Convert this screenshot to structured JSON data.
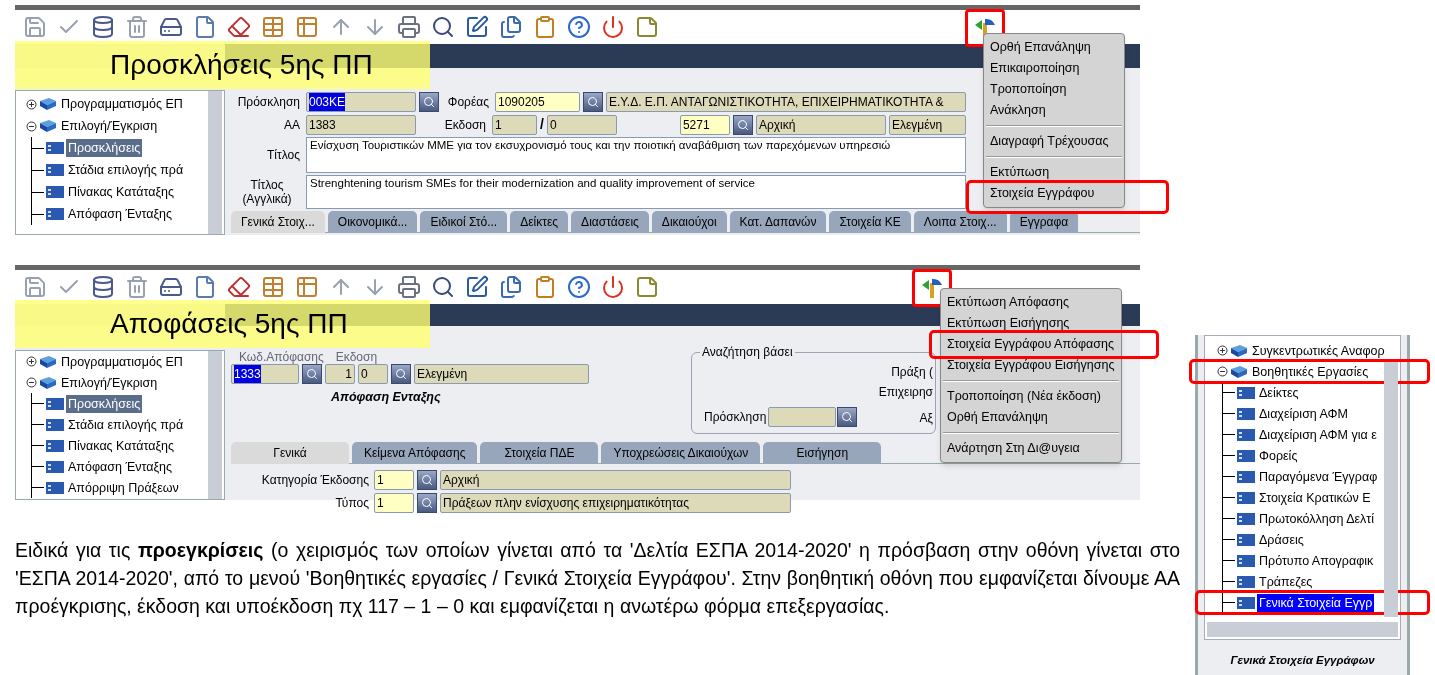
{
  "calls_screen": {
    "overlay_label": "Προσκλήσεις 5ης ΠΠ",
    "tools_button": {
      "highlighted": true
    },
    "tree": [
      {
        "label": "Προγραμματισμός ΕΠ",
        "expanded": false,
        "selected": false
      },
      {
        "label": "Επιλογή/Έγκριση",
        "expanded": true,
        "selected": false,
        "children": [
          {
            "label": "Προσκλήσεις",
            "selected": true
          },
          {
            "label": "Στάδια επιλογής πρά",
            "selected": false
          },
          {
            "label": "Πίνακας Κατάταξης",
            "selected": false
          },
          {
            "label": "Απόφαση Ένταξης",
            "selected": false
          }
        ]
      }
    ],
    "form": {
      "call_label": "Πρόσκληση",
      "call": {
        "value": "003ΚΕ",
        "editable": false,
        "text_selected": true
      },
      "body_label": "Φορέας",
      "body_code": {
        "value": "1090205",
        "editable": true,
        "text_selected": false
      },
      "body_name": {
        "value": "Ε.Υ.Δ. Ε.Π. ΑΝΤΑΓΩΝΙΣΤΙΚΟΤΗΤΑ, ΕΠΙΧΕΙΡΗΜΑΤΙΚΟΤΗΤΑ &",
        "editable": false,
        "text_selected": false
      },
      "aa_label": "ΑΑ",
      "aa": {
        "value": "1383",
        "editable": false,
        "text_selected": false
      },
      "version_label": "Εκδοση",
      "version": {
        "value": "1",
        "editable": false,
        "text_selected": false
      },
      "version_separator": "/",
      "subversion": {
        "value": "0",
        "editable": false,
        "text_selected": false
      },
      "type_code": {
        "value": "5271",
        "editable": true,
        "text_selected": false
      },
      "type_name": {
        "value": "Αρχική",
        "editable": false,
        "text_selected": false
      },
      "status": {
        "value": "Ελεγμένη",
        "editable": false,
        "text_selected": false
      },
      "title_label": "Τίτλος",
      "title": "Ενίσχυση Τουριστικών ΜΜΕ για τον εκσυχρονισμό τους και την ποιοτική αναβάθμιση των παρεχόμενων υπηρεσιώ",
      "title_en_label": [
        "Τίτλος",
        "(Αγγλικά)"
      ],
      "title_en": "Strenghtening tourism SMEs for their modernization and quality improvement of service"
    },
    "tabs": [
      {
        "label": "Γενικά Στοιχ...",
        "selected": true
      },
      {
        "label": "Οικονομικά...",
        "selected": false
      },
      {
        "label": "Ειδικοί Στό...",
        "selected": false
      },
      {
        "label": "Δείκτες",
        "selected": false
      },
      {
        "label": "Διαστάσεις",
        "selected": false
      },
      {
        "label": "Δικαιούχοι",
        "selected": false
      },
      {
        "label": "Κατ. Δαπανών",
        "selected": false
      },
      {
        "label": "Στοιχεία ΚΕ",
        "selected": false
      },
      {
        "label": "Λοιπα Στοιχ...",
        "selected": false
      },
      {
        "label": "Εγγραφα",
        "selected": false
      }
    ],
    "menu": [
      {
        "kind": "item",
        "label": "Ορθή Επανάληψη",
        "highlighted": false
      },
      {
        "kind": "item",
        "label": "Επικαιροποίηση",
        "highlighted": false
      },
      {
        "kind": "item",
        "label": "Τροποποίηση",
        "highlighted": false
      },
      {
        "kind": "item",
        "label": "Ανάκληση",
        "highlighted": false
      },
      {
        "kind": "separator"
      },
      {
        "kind": "item",
        "label": "Διαγραφή Τρέχουσας",
        "highlighted": false
      },
      {
        "kind": "separator"
      },
      {
        "kind": "item",
        "label": "Εκτύπωση",
        "highlighted": false
      },
      {
        "kind": "item",
        "label": "Στοιχεία Εγγράφου",
        "highlighted": true
      }
    ]
  },
  "decisions_screen": {
    "overlay_label": "Αποφάσεις 5ης ΠΠ",
    "tools_button": {
      "highlighted": true
    },
    "tree": [
      {
        "label": "Προγραμματισμός ΕΠ",
        "expanded": false,
        "selected": false
      },
      {
        "label": "Επιλογή/Έγκριση",
        "expanded": true,
        "selected": false,
        "children": [
          {
            "label": "Προσκλήσεις",
            "selected": true
          },
          {
            "label": "Στάδια επιλογής πρά",
            "selected": false
          },
          {
            "label": "Πίνακας Κατάταξης",
            "selected": false
          },
          {
            "label": "Απόφαση Ένταξης",
            "selected": false
          },
          {
            "label": "Απόρριψη Πράξεων",
            "selected": false
          }
        ]
      }
    ],
    "form": {
      "code_label": "Κωδ.Απόφασης",
      "version_label": "Εκδοση",
      "code": {
        "value": "1333",
        "editable": false,
        "text_selected": true
      },
      "version": {
        "value": "1",
        "editable": false,
        "text_selected": false
      },
      "subversion": {
        "value": "0",
        "editable": false,
        "text_selected": false
      },
      "status": {
        "value": "Ελεγμένη",
        "editable": false,
        "text_selected": false
      },
      "caption": "Απόφαση Ενταξης",
      "search_group": {
        "legend": "Αναζήτηση βάσει",
        "project_label": "Πράξη (",
        "business_label": "Επιχειρησ",
        "call_label": "Πρόσκληση",
        "call": {
          "editable": false
        },
        "score_label": "Αξ"
      }
    },
    "tabs": [
      {
        "label": "Γενικά",
        "selected": true
      },
      {
        "label": "Κείμενα Απόφασης",
        "selected": false
      },
      {
        "label": "Στοιχεία ΠΔΕ",
        "selected": false
      },
      {
        "label": "Υποχρεώσεις Δικαιούχων",
        "selected": false
      },
      {
        "label": "Εισήγηση",
        "selected": false
      }
    ],
    "rows": [
      {
        "label": "Κατηγορία Έκδοσης",
        "code": {
          "value": "1",
          "editable": true,
          "text_selected": false
        },
        "description": {
          "value": "Αρχική",
          "editable": false,
          "text_selected": false
        }
      },
      {
        "label": "Τύπος",
        "code": {
          "value": "1",
          "editable": true,
          "text_selected": false
        },
        "description": {
          "value": "Πράξεων πλην ενίσχυσης επιχειρηματικότητας",
          "editable": false,
          "text_selected": false
        }
      }
    ],
    "menu": [
      {
        "kind": "item",
        "label": "Εκτύπωση Απόφασης",
        "highlighted": false
      },
      {
        "kind": "item",
        "label": "Εκτύπωση Εισήγησης",
        "highlighted": false
      },
      {
        "kind": "item",
        "label": "Στοιχεία Εγγράφου Απόφασης",
        "highlighted": true
      },
      {
        "kind": "item",
        "label": "Στοιχεία Εγγράφου Εισήγησης",
        "highlighted": false
      },
      {
        "kind": "separator"
      },
      {
        "kind": "item",
        "label": "Τροποποίηση (Νέα έκδοση)",
        "highlighted": false
      },
      {
        "kind": "item",
        "label": "Ορθή Επανάληψη",
        "highlighted": false
      },
      {
        "kind": "separator"
      },
      {
        "kind": "item",
        "label": "Ανάρτηση Στη Δι@υγεια",
        "highlighted": false
      }
    ]
  },
  "auxiliary_tree": {
    "tree": [
      {
        "label": "Συγκεντρωτικές Αναφορ",
        "expanded": false,
        "selected": false,
        "highlighted": false
      },
      {
        "label": "Βοηθητικές Εργασίες",
        "expanded": true,
        "selected": false,
        "highlighted": true,
        "children": [
          {
            "label": "Δείκτες",
            "selected": false,
            "highlighted": false
          },
          {
            "label": "Διαχείριση ΑΦΜ",
            "selected": false,
            "highlighted": false
          },
          {
            "label": "Διαχείριση ΑΦΜ για ε",
            "selected": false,
            "highlighted": false
          },
          {
            "label": "Φορείς",
            "selected": false,
            "highlighted": false
          },
          {
            "label": "Παραγόμενα Έγγραφ",
            "selected": false,
            "highlighted": false
          },
          {
            "label": "Στοιχεία Κρατικών Ε",
            "selected": false,
            "highlighted": false
          },
          {
            "label": "Πρωτοκόλληση Δελτί",
            "selected": false,
            "highlighted": false
          },
          {
            "label": "Δράσεις",
            "selected": false,
            "highlighted": false
          },
          {
            "label": "Πρότυπο Απογραφικ",
            "selected": false,
            "highlighted": false
          },
          {
            "label": "Τράπεζες",
            "selected": false,
            "highlighted": false
          },
          {
            "label": "Γενικά Στοιχεία Εγγρ",
            "selected": true,
            "highlighted": true
          }
        ]
      }
    ],
    "caption": "Γενικά Στοιχεία Εγγράφων"
  },
  "paragraph": "Ειδικά για τις **προεγκρίσεις** (ο χειρισμός των οποίων γίνεται από τα 'Δελτία ΕΣΠΑ 2014-2020' η πρόσβαση στην οθόνη γίνεται στο 'ΕΣΠΑ 2014-2020', από το μενού 'Βοηθητικές εργασίες / Γενικά Στοιχεία Εγγράφου'. Στην βοηθητική οθόνη που εμφανίζεται δίνουμε ΑΑ προέγκρισης, έκδοση και υποέκδοση πχ 117 – 1 – 0 και εμφανίζεται η ανωτέρω φόρμα επεξεργασίας."
}
